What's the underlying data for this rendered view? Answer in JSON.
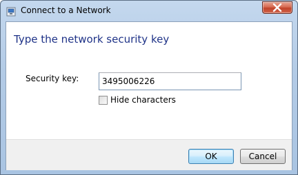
{
  "window": {
    "title": "Connect to a Network",
    "icon": "network-icon",
    "close_icon": "close-icon"
  },
  "dialog": {
    "heading": "Type the network security key",
    "security_key_label": "Security key:",
    "security_key_value": "3495006226",
    "hide_characters_label": "Hide characters",
    "hide_characters_checked": false
  },
  "buttons": {
    "ok_label": "OK",
    "cancel_label": "Cancel"
  },
  "colors": {
    "heading": "#1e3287",
    "title_bar": "#b3cbe6",
    "close_button": "#c0432a",
    "footer": "#f0f0f0"
  }
}
